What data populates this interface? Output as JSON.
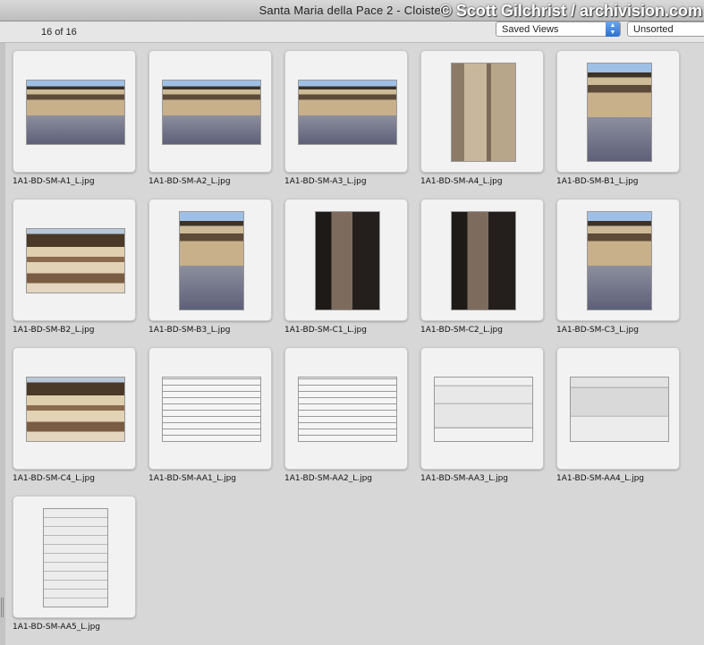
{
  "window": {
    "title": "Santa Maria della Pace 2 - Cloister"
  },
  "watermark": "© Scott Gilchrist / archivision.com",
  "toolbar": {
    "count": "16 of 16",
    "saved_views": "Saved Views",
    "sort": "Unsorted"
  },
  "images": [
    {
      "file": "1A1-BD-SM-A1_L.jpg",
      "kind": "court"
    },
    {
      "file": "1A1-BD-SM-A2_L.jpg",
      "kind": "court"
    },
    {
      "file": "1A1-BD-SM-A3_L.jpg",
      "kind": "court"
    },
    {
      "file": "1A1-BD-SM-A4_L.jpg",
      "kind": "pillar"
    },
    {
      "file": "1A1-BD-SM-B1_L.jpg",
      "kind": "court"
    },
    {
      "file": "1A1-BD-SM-B2_L.jpg",
      "kind": "arcade"
    },
    {
      "file": "1A1-BD-SM-B3_L.jpg",
      "kind": "court"
    },
    {
      "file": "1A1-BD-SM-C1_L.jpg",
      "kind": "pillar-dark"
    },
    {
      "file": "1A1-BD-SM-C2_L.jpg",
      "kind": "pillar-dark"
    },
    {
      "file": "1A1-BD-SM-C3_L.jpg",
      "kind": "court"
    },
    {
      "file": "1A1-BD-SM-C4_L.jpg",
      "kind": "arcade"
    },
    {
      "file": "1A1-BD-SM-AA1_L.jpg",
      "kind": "plan"
    },
    {
      "file": "1A1-BD-SM-AA2_L.jpg",
      "kind": "plan"
    },
    {
      "file": "1A1-BD-SM-AA3_L.jpg",
      "kind": "elevation"
    },
    {
      "file": "1A1-BD-SM-AA4_L.jpg",
      "kind": "section"
    },
    {
      "file": "1A1-BD-SM-AA5_L.jpg",
      "kind": "elevation-tall"
    }
  ]
}
